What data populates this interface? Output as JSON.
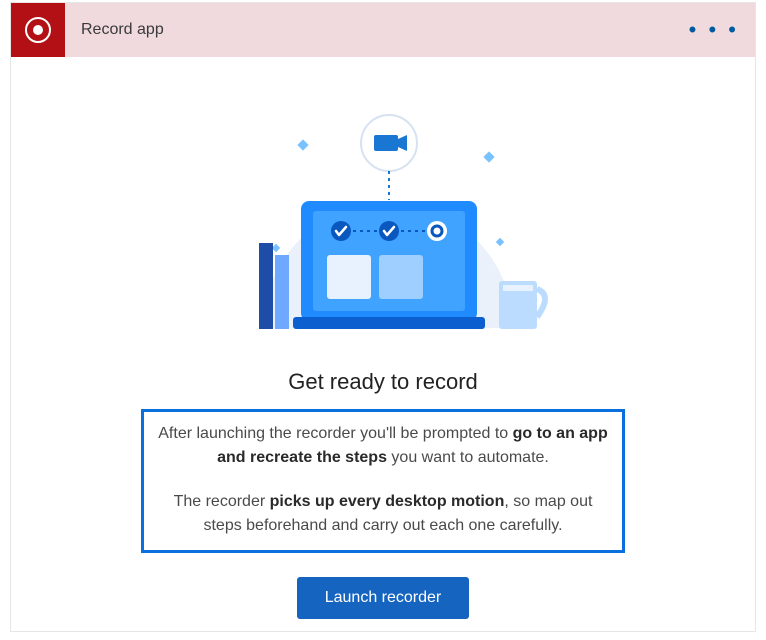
{
  "header": {
    "title": "Record app",
    "icon_name": "record-icon",
    "more_icon_name": "more-icon"
  },
  "content": {
    "illustration_name": "record-illustration",
    "heading": "Get ready to record",
    "description": {
      "p1a": "After launching the recorder you'll be prompted to ",
      "p1b": "go to an app and recreate the steps",
      "p1c": " you want to automate.",
      "p2a": "The recorder ",
      "p2b": "picks up every desktop motion",
      "p2c": ", so map out steps beforehand and carry out each one carefully."
    },
    "launch_button_label": "Launch recorder"
  },
  "colors": {
    "accent_blue": "#1565c0",
    "header_bg": "#f0dadd",
    "header_icon_bg": "#b21015"
  }
}
